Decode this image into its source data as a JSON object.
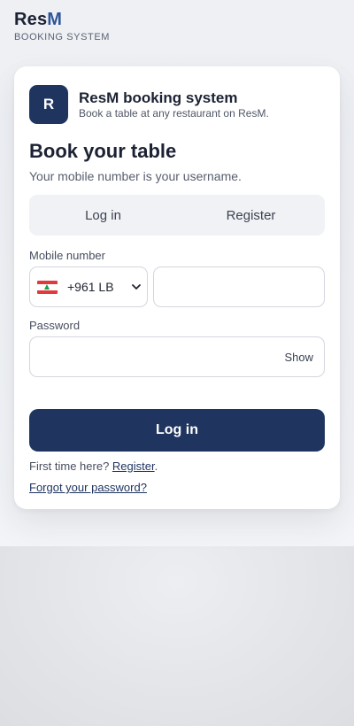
{
  "brand": {
    "name_main": "Res",
    "name_accent": "M",
    "subtitle": "BOOKING SYSTEM"
  },
  "card": {
    "logo_letter": "R",
    "title": "ResM booking system",
    "subtitle": "Book a table at any restaurant on ResM."
  },
  "form": {
    "heading": "Book your table",
    "subheading": "Your mobile number is your username.",
    "tabs": [
      {
        "label": "Log in",
        "active": true
      },
      {
        "label": "Register",
        "active": false
      }
    ],
    "mobile_label": "Mobile number",
    "country_code": "+961 LB",
    "country_flag_icon": "lebanon-flag-icon",
    "mobile_value": "",
    "password_label": "Password",
    "password_value": "",
    "show_label": "Show",
    "submit_label": "Log in",
    "first_time_text": "First time here? ",
    "register_link": "Register",
    "first_time_suffix": ".",
    "forgot_link": "Forgot your password?"
  },
  "colors": {
    "primary": "#1f3560",
    "accent": "#2f5597",
    "flag_red": "#e03a3e",
    "flag_green": "#17a34a"
  }
}
